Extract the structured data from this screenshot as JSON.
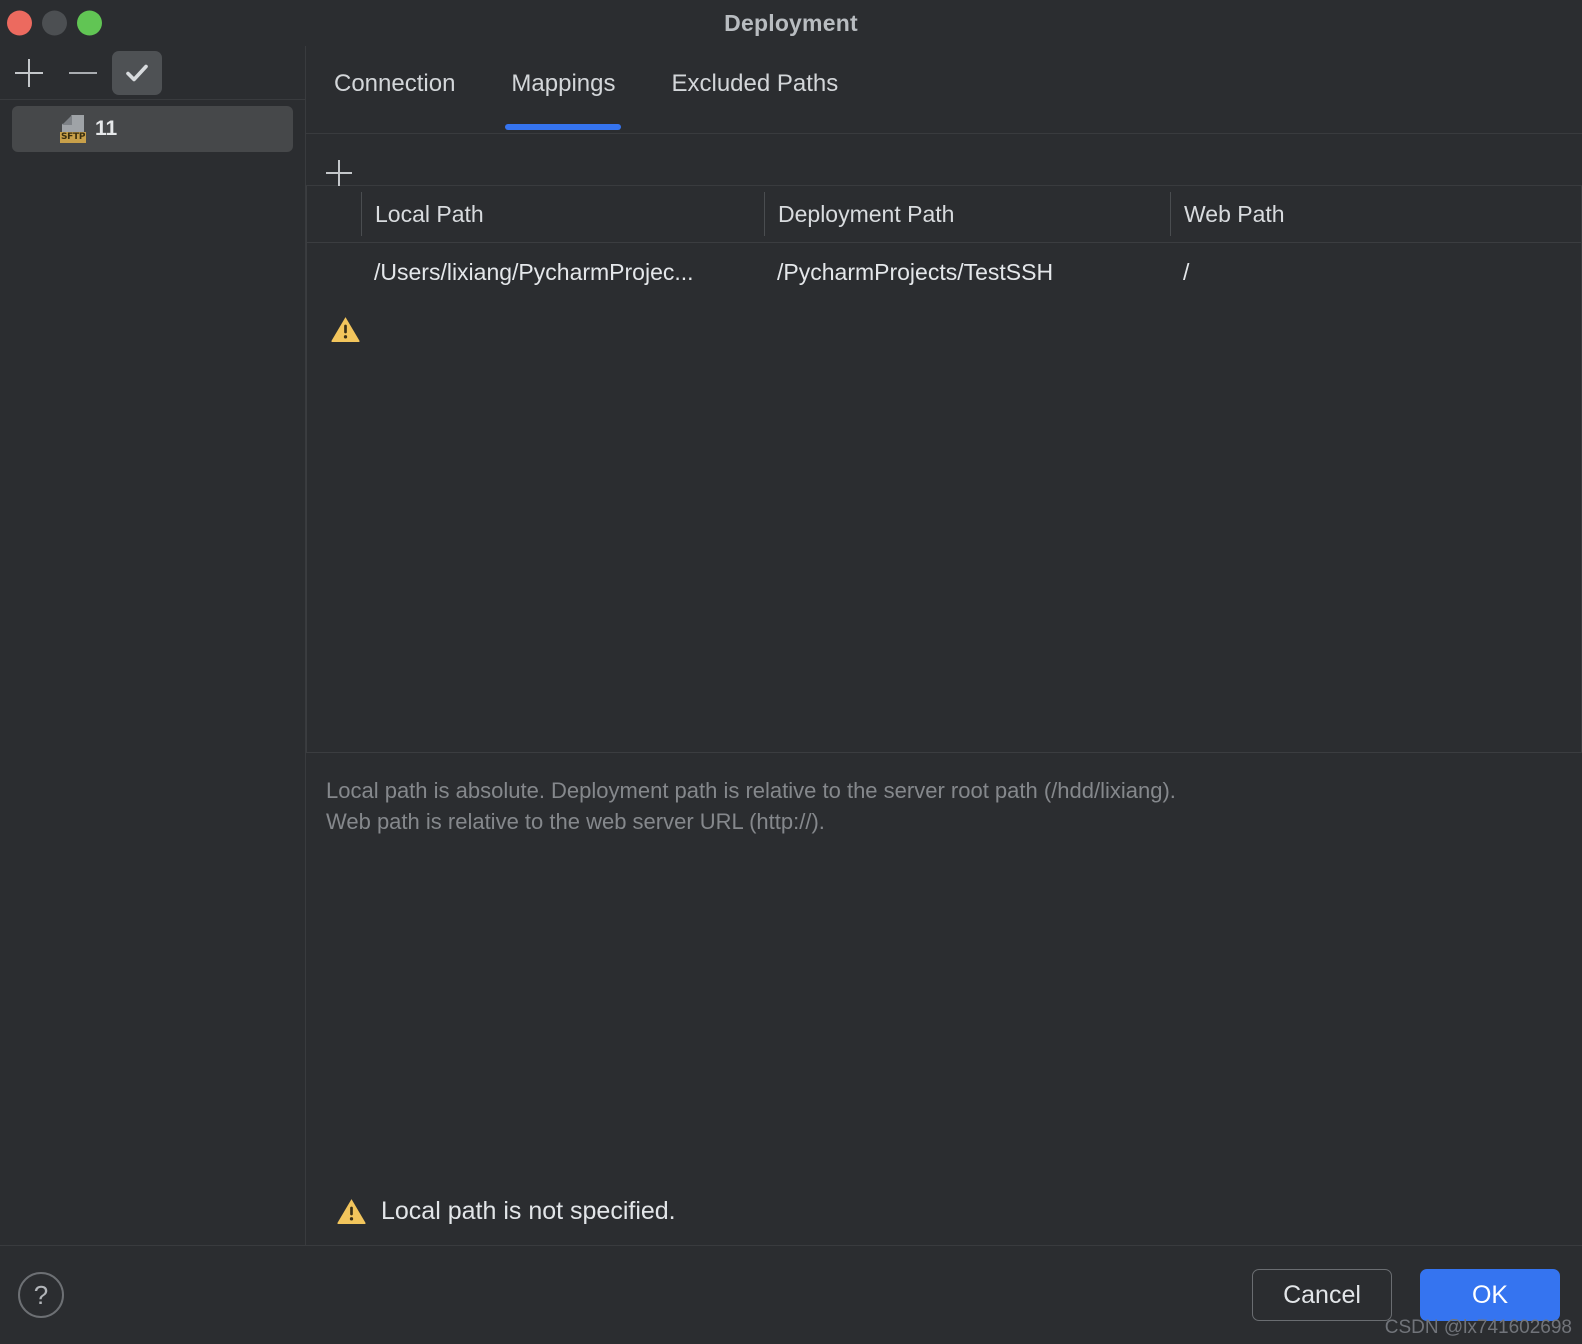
{
  "window": {
    "title": "Deployment",
    "traffic_lights": [
      "close",
      "minimize",
      "zoom"
    ]
  },
  "sidebar": {
    "toolbar": [
      {
        "name": "add",
        "icon": "plus-icon",
        "label": "+"
      },
      {
        "name": "remove",
        "icon": "minus-icon",
        "label": "—"
      },
      {
        "name": "set-default",
        "icon": "check-icon",
        "label": "✓"
      }
    ],
    "servers": [
      {
        "name": "11",
        "badge": "SFTP",
        "icon": "sftp-server-icon",
        "selected": true
      }
    ]
  },
  "tabs": [
    {
      "label": "Connection",
      "selected": false
    },
    {
      "label": "Mappings",
      "selected": true
    },
    {
      "label": "Excluded Paths",
      "selected": false
    }
  ],
  "mappings_toolbar": {
    "add_label": "+",
    "remove_label": "—"
  },
  "table": {
    "columns": [
      "Local Path",
      "Deployment Path",
      "Web Path"
    ],
    "rows": [
      {
        "local_path": "/Users/lixiang/PycharmProjec...",
        "deployment_path": "/PycharmProjects/TestSSH",
        "web_path": "/"
      }
    ],
    "warning_row_icon": "warning-triangle-icon"
  },
  "hint": {
    "line1": "Local path is absolute. Deployment path is relative to the server root path (/hdd/lixiang).",
    "line2": "Web path is relative to the web server URL (http://)."
  },
  "error": {
    "icon": "warning-triangle-icon",
    "message": "Local path is not specified."
  },
  "footer": {
    "help_label": "?",
    "cancel_label": "Cancel",
    "ok_label": "OK"
  },
  "watermark": "CSDN @lx741602698",
  "colors": {
    "background": "#2b2d30",
    "selection": "#46484a",
    "accent": "#3574f0",
    "warning": "#f2c55c",
    "sftp_badge": "#c8a04a",
    "text": "#e2e5e8",
    "muted_text": "#85888c"
  }
}
